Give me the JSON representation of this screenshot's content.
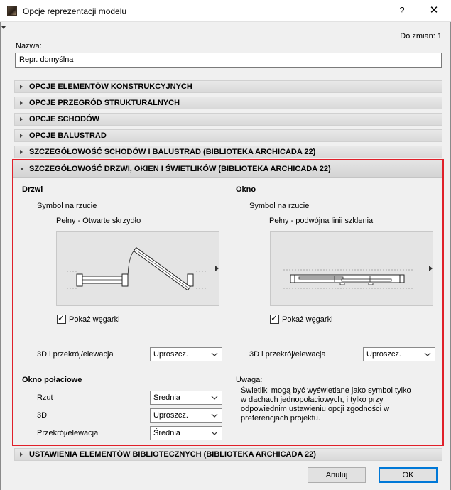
{
  "window": {
    "title": "Opcje reprezentacji modelu",
    "help": "?",
    "close": "✕"
  },
  "changes": "Do zmian: 1",
  "name": {
    "label": "Nazwa:",
    "value": "Repr. domyślna"
  },
  "sections": [
    "OPCJE ELEMENTÓW KONSTRUKCYJNYCH",
    "OPCJE PRZEGRÓD STRUKTURALNYCH",
    "OPCJE SCHODÓW",
    "OPCJE BALUSTRAD",
    "SZCZEGÓŁOWOŚĆ SCHODÓW I BALUSTRAD (BIBLIOTEKA ARCHICADA 22)"
  ],
  "expanded": {
    "title": "SZCZEGÓŁOWOŚĆ DRZWI, OKIEN I ŚWIETLIKÓW (BIBLIOTEKA ARCHICADA 22)",
    "doors": {
      "heading": "Drzwi",
      "symbol_label": "Symbol na rzucie",
      "symbol_value": "Pełny - Otwarte skrzydło",
      "show_reveals": "Pokaż węgarki",
      "show_reveals_checked": true,
      "view3d_label": "3D i przekrój/elewacja",
      "view3d_value": "Uproszcz."
    },
    "window": {
      "heading": "Okno",
      "symbol_label": "Symbol na rzucie",
      "symbol_value": "Pełny - podwójna linii szklenia",
      "show_reveals": "Pokaż węgarki",
      "show_reveals_checked": true,
      "view3d_label": "3D i przekrój/elewacja",
      "view3d_value": "Uproszcz."
    },
    "skylight": {
      "heading": "Okno połaciowe",
      "plan_label": "Rzut",
      "plan_value": "Średnia",
      "d3_label": "3D",
      "d3_value": "Uproszcz.",
      "section_label": "Przekrój/elewacja",
      "section_value": "Średnia"
    },
    "note": {
      "label": "Uwaga:",
      "text": "Świetliki mogą być wyświetlane jako symbol tylko w dachach jednopołaciowych, i tylko przy odpowiednim ustawieniu opcji zgodności w preferencjach projektu."
    }
  },
  "library_section": "USTAWIENIA ELEMENTÓW BIBLIOTECZNYCH (BIBLIOTEKA ARCHICADA 22)",
  "buttons": {
    "cancel": "Anuluj",
    "ok": "OK"
  },
  "colors": {
    "highlight_border": "#e0202a",
    "ok_border": "#0078d7"
  }
}
